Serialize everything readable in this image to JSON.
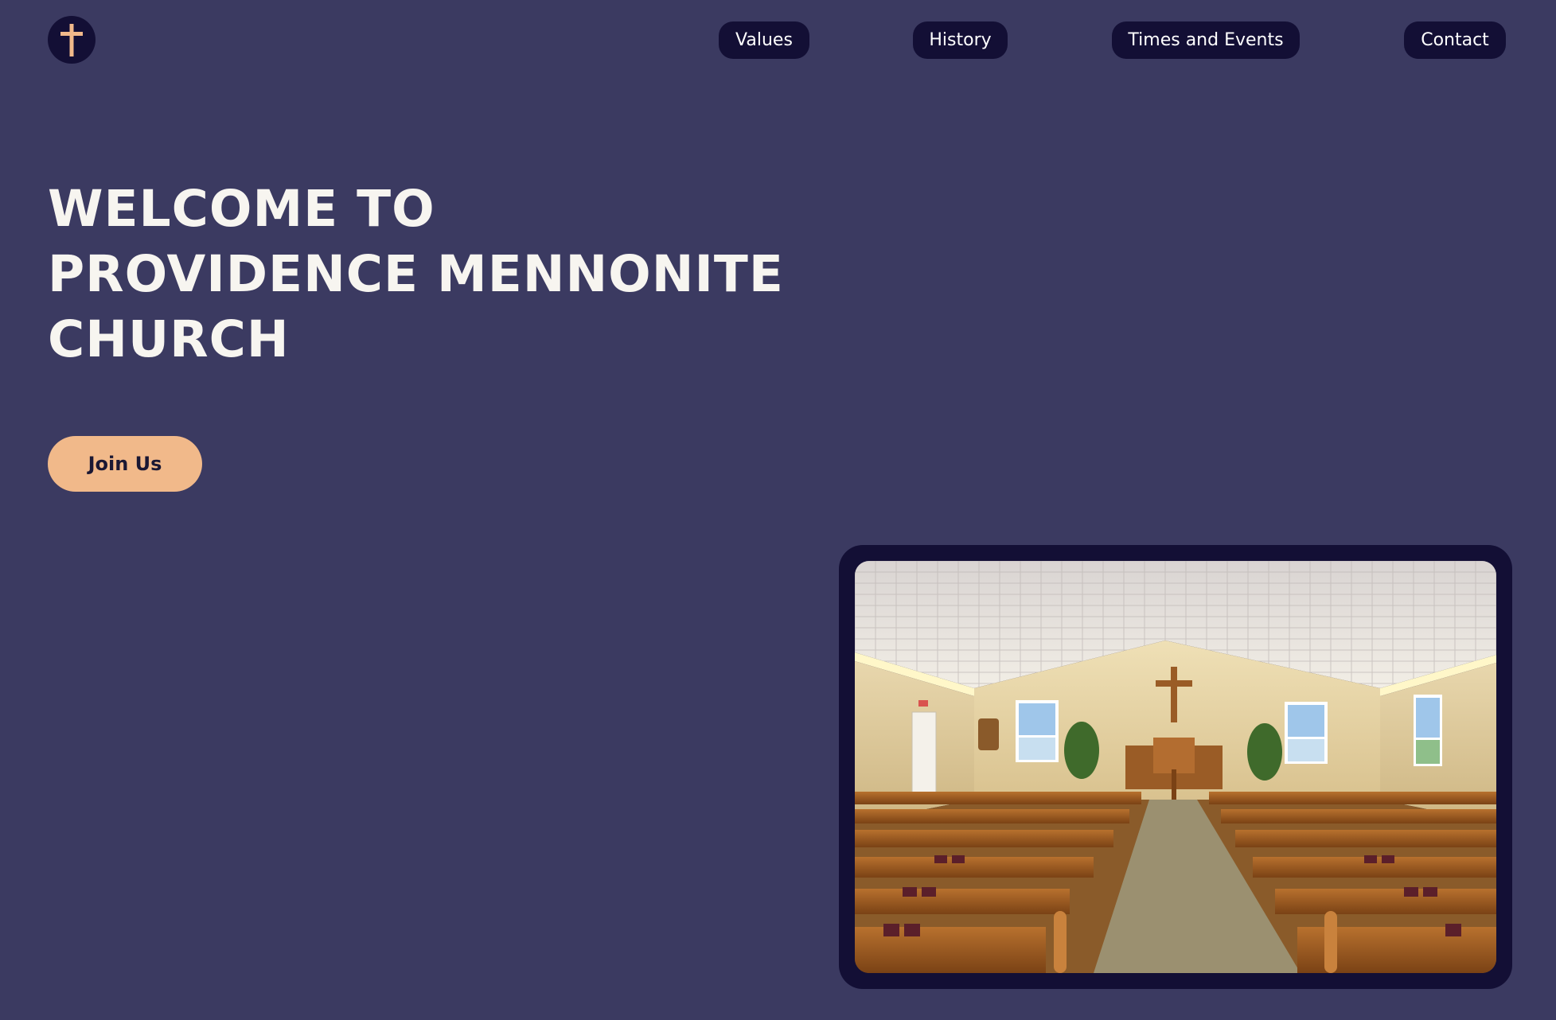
{
  "logo": {
    "icon": "cross-icon",
    "accent_color": "#f1b98a"
  },
  "nav": {
    "items": [
      {
        "label": "Values"
      },
      {
        "label": "History"
      },
      {
        "label": "Times and Events"
      },
      {
        "label": "Contact"
      }
    ]
  },
  "hero": {
    "title_lines": [
      "WELCOME TO",
      "PROVIDENCE MENNONITE",
      "CHURCH"
    ],
    "cta_label": "Join Us"
  },
  "photo": {
    "subject": "church-sanctuary-interior"
  },
  "colors": {
    "background": "#3b3a61",
    "nav_bg": "#130f35",
    "accent": "#f1b98a",
    "title": "#f7f5f0"
  }
}
